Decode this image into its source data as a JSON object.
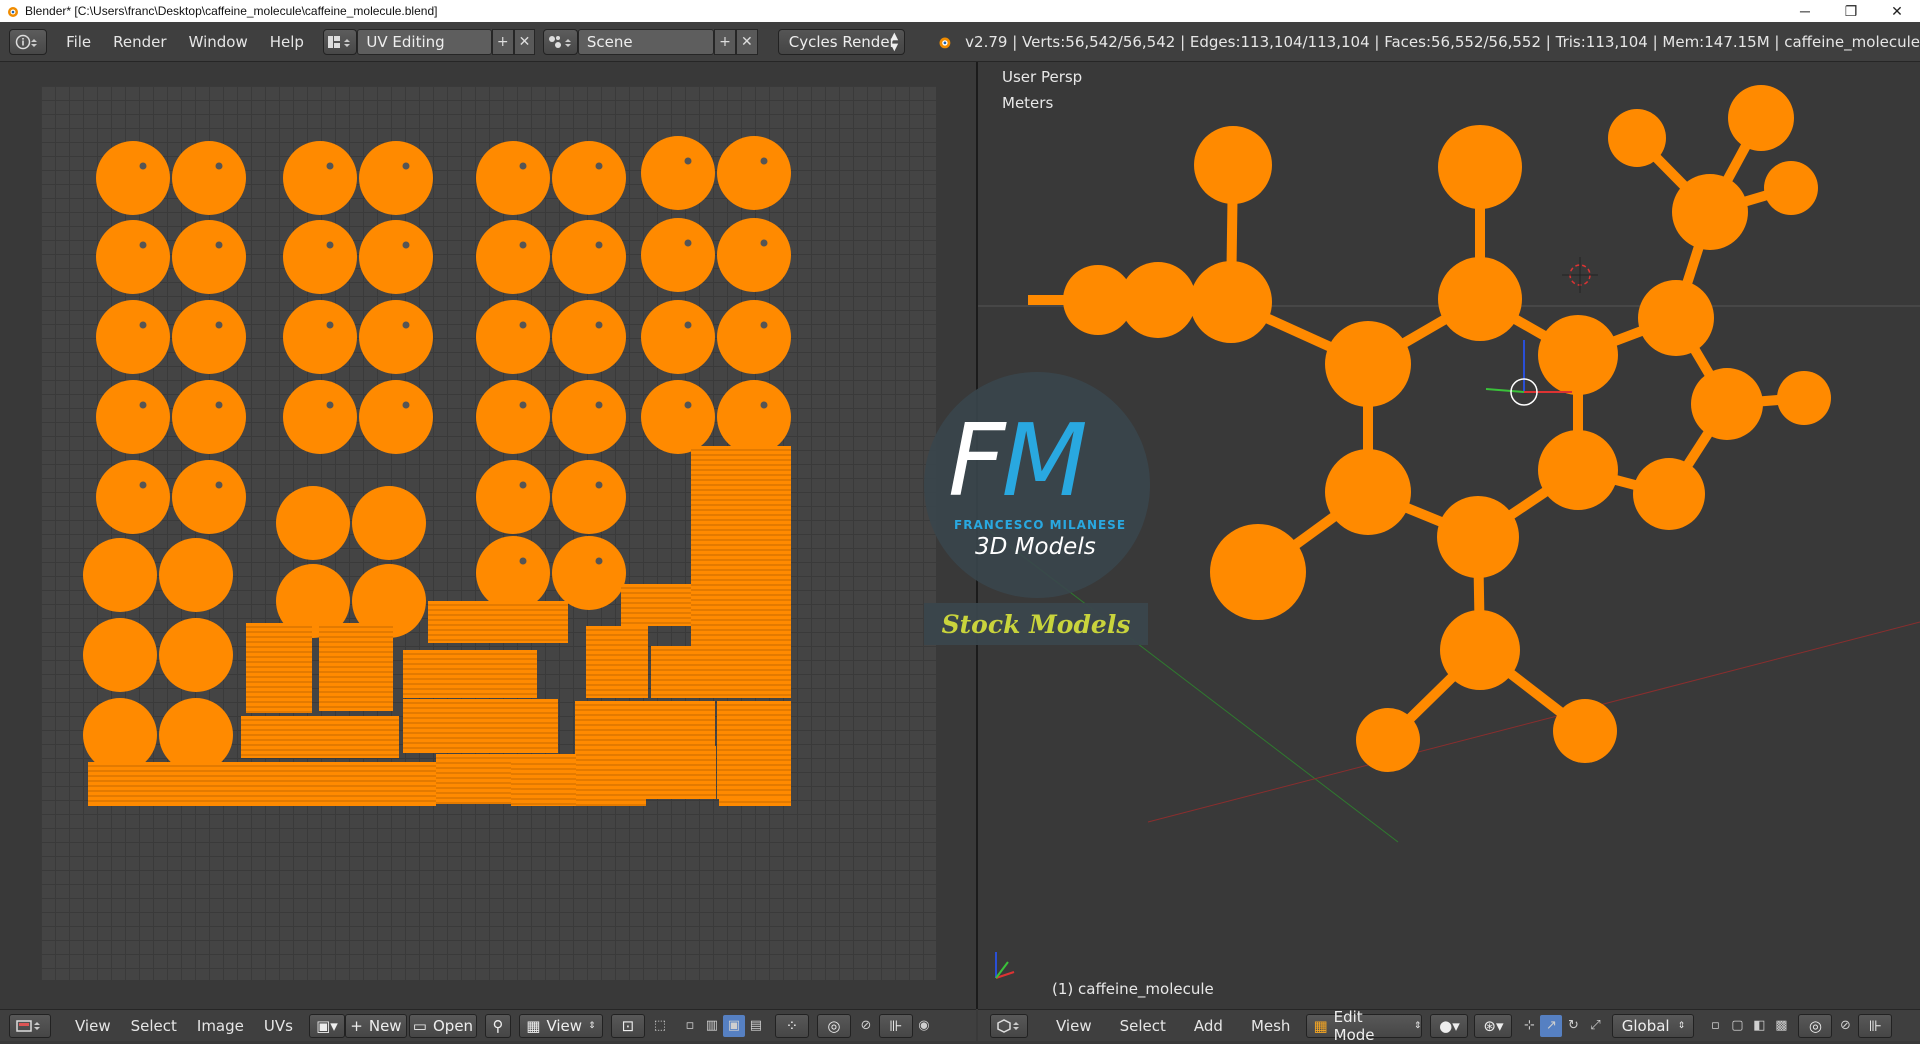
{
  "window": {
    "title": "Blender* [C:\\Users\\franc\\Desktop\\caffeine_molecule\\caffeine_molecule.blend]",
    "controls": {
      "minimize": "─",
      "maximize": "❐",
      "close": "✕"
    }
  },
  "info_header": {
    "menus": [
      "File",
      "Render",
      "Window",
      "Help"
    ],
    "layout": "UV Editing",
    "scene": "Scene",
    "render_engine": "Cycles Render",
    "stats": "v2.79 | Verts:56,542/56,542 | Edges:113,104/113,104 | Faces:56,552/56,552 | Tris:113,104 | Mem:147.15M | caffeine_molecule"
  },
  "uv_editor": {
    "menus": [
      "View",
      "Select",
      "Image",
      "UVs"
    ],
    "new_label": "New",
    "open_label": "Open",
    "view_label": "View"
  },
  "viewport": {
    "view_name": "User Persp",
    "units": "Meters",
    "object_label": "(1) caffeine_molecule",
    "menus": [
      "View",
      "Select",
      "Add",
      "Mesh"
    ],
    "mode": "Edit Mode",
    "orientation": "Global"
  },
  "watermark": {
    "logo_f": "F",
    "logo_m": "M",
    "name": "FRANCESCO MILANESE",
    "subtitle": "3D Models",
    "banner": "Stock Models"
  },
  "colors": {
    "orange": "#ff8a00",
    "background": "#393939",
    "header": "#3f3f3f",
    "accent_blue": "#29a8e0"
  }
}
